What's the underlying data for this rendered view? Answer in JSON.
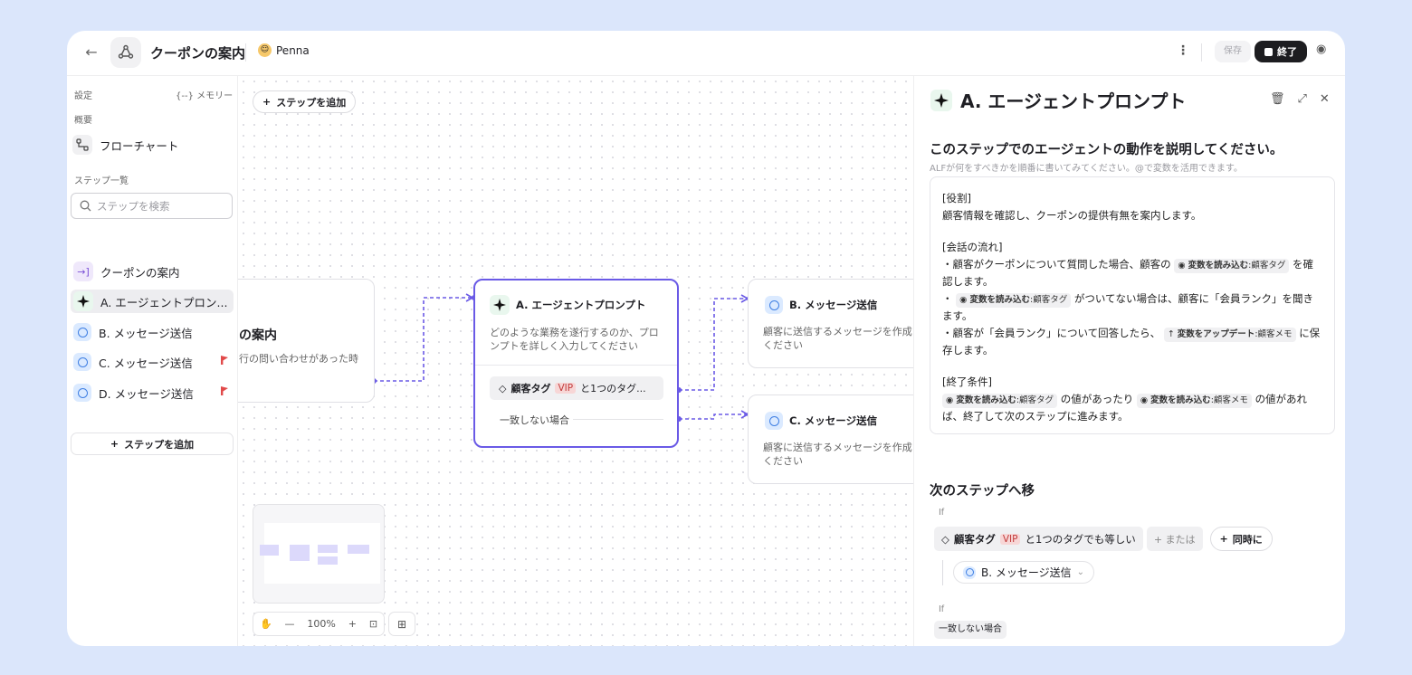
{
  "header": {
    "title": "クーポンの案内",
    "user": "Penna",
    "save_label": "保存",
    "end_label": "終了"
  },
  "sidebar": {
    "settings_label": "設定",
    "memory_label": "{--} メモリー",
    "overview_label": "概要",
    "flowchart_label": "フローチャート",
    "steps_label": "ステップ一覧",
    "search_placeholder": "ステップを検索",
    "items": [
      {
        "label": "クーポンの案内",
        "icon": "enter-icon"
      },
      {
        "label": "A. エージェントプロン...",
        "icon": "sparkle-icon"
      },
      {
        "label": "B. メッセージ送信",
        "icon": "message-icon"
      },
      {
        "label": "C. メッセージ送信",
        "icon": "message-icon",
        "flag": true
      },
      {
        "label": "D. メッセージ送信",
        "icon": "message-icon",
        "flag": true
      }
    ],
    "add_step_label": "ステップを追加"
  },
  "canvas": {
    "add_step_label": "ステップを追加",
    "trigger": {
      "title": "の案内",
      "desc": "行の問い合わせがあった時"
    },
    "agent": {
      "title": "A. エージェントプロンプト",
      "desc": "どのような業務を遂行するのか、プロンプトを詳しく入力してください",
      "chip_label": "顧客タグ",
      "chip_vip": "VIP",
      "chip_rest": "と1つのタグ...",
      "nomatch": "一致しない場合"
    },
    "msg_b": {
      "title": "B. メッセージ送信",
      "desc": "顧客に送信するメッセージを作成ください"
    },
    "msg_c": {
      "title": "C. メッセージ送信",
      "desc": "顧客に送信するメッセージを作成ください"
    },
    "zoom": "100%"
  },
  "panel": {
    "title": "A. エージェントプロンプト",
    "question": "このステップでのエージェントの動作を説明してください。",
    "hint": "ALFが何をすべきかを順番に書いてみてください。@で変数を活用できます。",
    "role_heading": "[役割]",
    "role_text": "顧客情報を確認し、クーポンの提供有無を案内します。",
    "flow_heading": "[会話の流れ]",
    "line1a": "・顧客がクーポンについて質問した場合、顧客の",
    "line1b": "を確認します。",
    "line2a": "・",
    "line2b": "がついてない場合は、顧客に「会員ランク」を聞きます。",
    "line3a": "・顧客が「会員ランク」について回答したら、",
    "line3b": "に保存します。",
    "end_heading": "[終了条件]",
    "end_a": "の値があったり",
    "end_b": "の値があれば、終了して次のステップに進みます。",
    "var_read": "変数を読み込む",
    "var_update": "変数をアップデート",
    "var_tag": "顧客タグ",
    "var_memo": "顧客メモ",
    "next_heading": "次のステップへ移",
    "if_label": "If",
    "cond_label": "顧客タグ",
    "cond_vip": "VIP",
    "cond_rest": "と1つのタグでも等しい",
    "or_label": "+ または",
    "and_label": "同時に",
    "target_label": "B. メッセージ送信",
    "if2_label": "If",
    "nomatch_label": "一致しない場合"
  }
}
